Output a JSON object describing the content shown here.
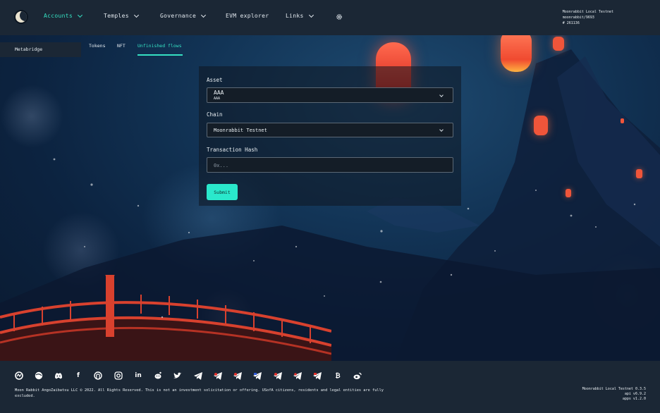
{
  "header": {
    "nav": [
      {
        "label": "Accounts",
        "active": true
      },
      {
        "label": "Temples"
      },
      {
        "label": "Governance"
      },
      {
        "label": "EVM explorer"
      },
      {
        "label": "Links"
      }
    ],
    "chain_name": "Moonrabbit Local Testnet",
    "chain_sub": "moonrabbit/9693",
    "block": "# 261136"
  },
  "subnav": {
    "section": "Metabridge",
    "tabs": [
      "Tokens",
      "NFT",
      "Unfinished flows"
    ],
    "active_tab": "Unfinished flows"
  },
  "form": {
    "asset_label": "Asset",
    "asset_value": "AAA",
    "asset_sub": "AAA",
    "chain_label": "Chain",
    "chain_value": "Moonrabbit Testnet",
    "hash_label": "Transaction Hash",
    "hash_placeholder": "0x...",
    "submit_label": "Submit"
  },
  "footer": {
    "icons": [
      "moonrabbit-icon",
      "globe-icon",
      "discord-icon",
      "facebook-icon",
      "github-icon",
      "instagram-icon",
      "linkedin-icon",
      "reddit-icon",
      "twitter-icon",
      "telegram-icon",
      "telegram-red-icon",
      "telegram-flag-icon",
      "telegram-ru-icon",
      "telegram-kr-icon",
      "telegram-jp-icon",
      "telegram-cn-icon",
      "bitcoin-icon",
      "weibo-icon"
    ],
    "copyright": "Moon Rabbit AngoZaibatsu LLC © 2022. All Rights Reserved. This is not an investment solicitation or offering. USofA citizens, residents and legal entities are fully excluded.",
    "version_title": "Moonrabbit Local Testnet 0.3.5",
    "api_version": "api v6.9.2",
    "apps_version": "apps v1.2.0"
  },
  "colors": {
    "accent": "#35e0c2",
    "bar": "#1b2735",
    "button": "#2ae8cc"
  }
}
